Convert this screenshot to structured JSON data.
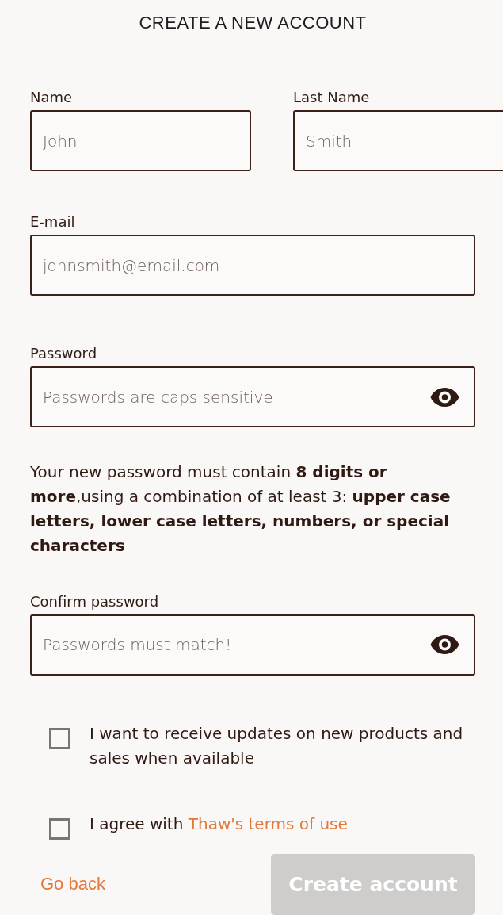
{
  "title": "CREATE A NEW ACCOUNT",
  "name_row": [
    {
      "label": "Name",
      "placeholder": "John"
    },
    {
      "label": "Last Name",
      "placeholder": "Smith"
    }
  ],
  "email": {
    "label": "E-mail",
    "placeholder": "johnsmith@email.com"
  },
  "password": {
    "label": "Password",
    "placeholder": "Passwords are caps sensitive"
  },
  "password_hint": "Your new password must contain **8 digits or more**,using a combination of at least 3: **upper case letters, lower case letters, numbers, or special characters**",
  "confirm_password": {
    "label": "Confirm password",
    "placeholder": "Passwords must match!"
  },
  "checkboxes": [
    {
      "text": "I want to receive updates on new products and sales when available",
      "checked": false
    },
    {
      "text": "I agree with",
      "link": "Thaw's terms of use",
      "checked": false
    }
  ],
  "go_back": "Go back",
  "create_button": {
    "label": "Create account",
    "disabled": true
  }
}
